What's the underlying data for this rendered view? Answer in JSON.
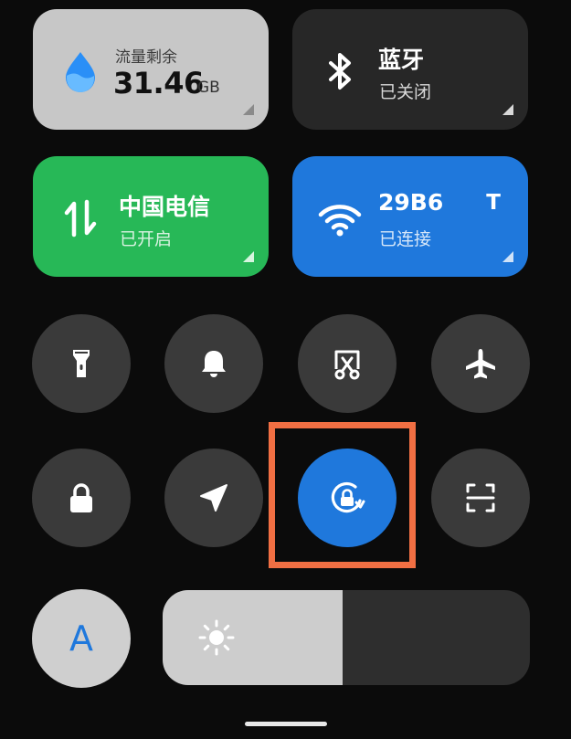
{
  "tiles": {
    "data": {
      "label": "流量剩余",
      "value": "31.46",
      "unit": "GB"
    },
    "bluetooth": {
      "title": "蓝牙",
      "status": "已关闭"
    },
    "cellular": {
      "title": "中国电信",
      "status": "已开启"
    },
    "wifi": {
      "title": "29B6",
      "extra": "T",
      "status": "已连接"
    }
  },
  "toggles": [
    {
      "icon": "flashlight-icon",
      "active": false
    },
    {
      "icon": "bell-icon",
      "active": false
    },
    {
      "icon": "screenshot-icon",
      "active": false
    },
    {
      "icon": "airplane-icon",
      "active": false
    },
    {
      "icon": "lock-icon",
      "active": false
    },
    {
      "icon": "location-icon",
      "active": false
    },
    {
      "icon": "rotation-lock-icon",
      "active": true
    },
    {
      "icon": "scan-icon",
      "active": false
    }
  ],
  "auto_brightness": {
    "letter": "A"
  },
  "brightness": {
    "level": 0.49
  },
  "colors": {
    "active_blue": "#1f78dc",
    "cellular_green": "#27b857",
    "highlight_orange": "#f16f43"
  }
}
